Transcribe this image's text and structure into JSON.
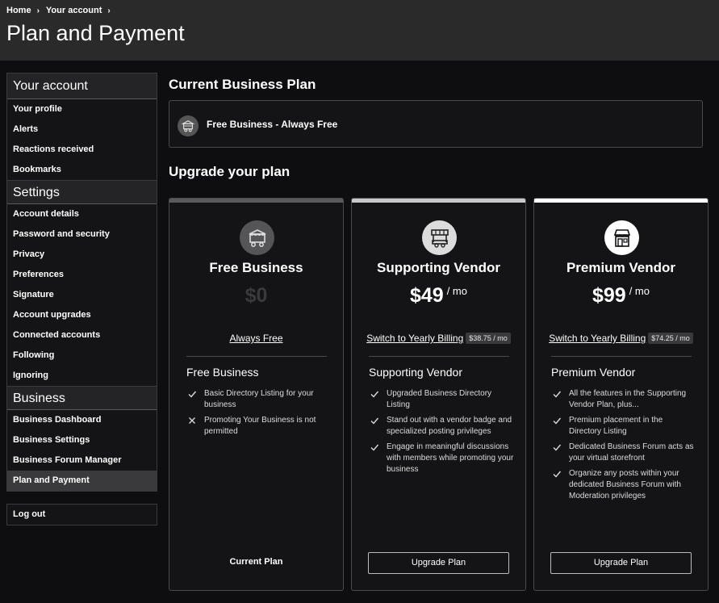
{
  "breadcrumb": {
    "items": [
      "Home",
      "Your account"
    ],
    "separator": "›"
  },
  "page_title": "Plan and Payment",
  "sidebar": {
    "sections": [
      {
        "heading": "Your account",
        "items": [
          "Your profile",
          "Alerts",
          "Reactions received",
          "Bookmarks"
        ]
      },
      {
        "heading": "Settings",
        "items": [
          "Account details",
          "Password and security",
          "Privacy",
          "Preferences",
          "Signature",
          "Account upgrades",
          "Connected accounts",
          "Following",
          "Ignoring"
        ]
      },
      {
        "heading": "Business",
        "items": [
          "Business Dashboard",
          "Business Settings",
          "Business Forum Manager",
          "Plan and Payment"
        ]
      }
    ],
    "active_item": "Plan and Payment",
    "logout_label": "Log out"
  },
  "current_plan": {
    "section_title": "Current Business Plan",
    "plan_text": "Free Business - Always Free",
    "icon": "food-truck-icon"
  },
  "upgrade": {
    "section_title": "Upgrade your plan",
    "plans": [
      {
        "name": "Free Business",
        "price": "$0",
        "per": "",
        "billing_text": "Always Free",
        "yearly_badge": "",
        "plan_label": "Free Business",
        "features": [
          {
            "text": "Basic Directory Listing for your business",
            "included": true
          },
          {
            "text": "Promoting Your Business is not permitted",
            "included": false
          }
        ],
        "action_label": "Current Plan",
        "is_current": true,
        "accent_color": "#5a5a5c",
        "icon": "food-truck-icon"
      },
      {
        "name": "Supporting Vendor",
        "price": "$49",
        "per": "/ mo",
        "billing_text": "Switch to Yearly Billing",
        "yearly_badge": "$38.75 / mo",
        "plan_label": "Supporting Vendor",
        "features": [
          {
            "text": "Upgraded Business Directory Listing",
            "included": true
          },
          {
            "text": "Stand out with a vendor badge and specialized posting privileges",
            "included": true
          },
          {
            "text": "Engage in meaningful discussions with members while promoting your business",
            "included": true
          }
        ],
        "action_label": "Upgrade Plan",
        "is_current": false,
        "accent_color": "#c8c8c8",
        "icon": "market-stall-icon"
      },
      {
        "name": "Premium Vendor",
        "price": "$99",
        "per": "/ mo",
        "billing_text": "Switch to Yearly Billing",
        "yearly_badge": "$74.25 / mo",
        "plan_label": "Premium Vendor",
        "features": [
          {
            "text": "All the features in the Supporting Vendor Plan, plus...",
            "included": true
          },
          {
            "text": "Premium placement in the Directory Listing",
            "included": true
          },
          {
            "text": "Dedicated Business Forum acts as your virtual storefront",
            "included": true
          },
          {
            "text": "Organize any posts within your dedicated Business Forum with Moderation privileges",
            "included": true
          }
        ],
        "action_label": "Upgrade Plan",
        "is_current": false,
        "accent_color": "#ffffff",
        "icon": "storefront-icon"
      }
    ]
  },
  "colors": {
    "background": "#0e0e10",
    "header": "#2a2a2b",
    "panel": "#141416",
    "border": "#4a4a4c"
  }
}
